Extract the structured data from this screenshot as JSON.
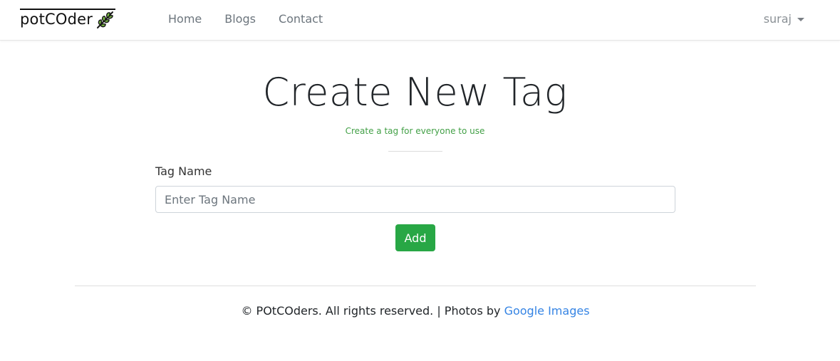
{
  "brand": {
    "name": "potCOder",
    "icon": "leaf-icon"
  },
  "nav": {
    "items": [
      {
        "label": "Home"
      },
      {
        "label": "Blogs"
      },
      {
        "label": "Contact"
      }
    ],
    "user": {
      "name": "suraj"
    }
  },
  "page": {
    "title": "Create New Tag",
    "subtitle": "Create a tag for everyone to use"
  },
  "form": {
    "label": "Tag Name",
    "placeholder": "Enter Tag Name",
    "value": "",
    "submit_label": "Add"
  },
  "footer": {
    "text": "© POtCOders. All rights reserved. | Photos by ",
    "link_label": "Google Images"
  },
  "colors": {
    "accent_green": "#28a745",
    "subtitle_green": "#43a047",
    "link_blue": "#3584e4"
  }
}
